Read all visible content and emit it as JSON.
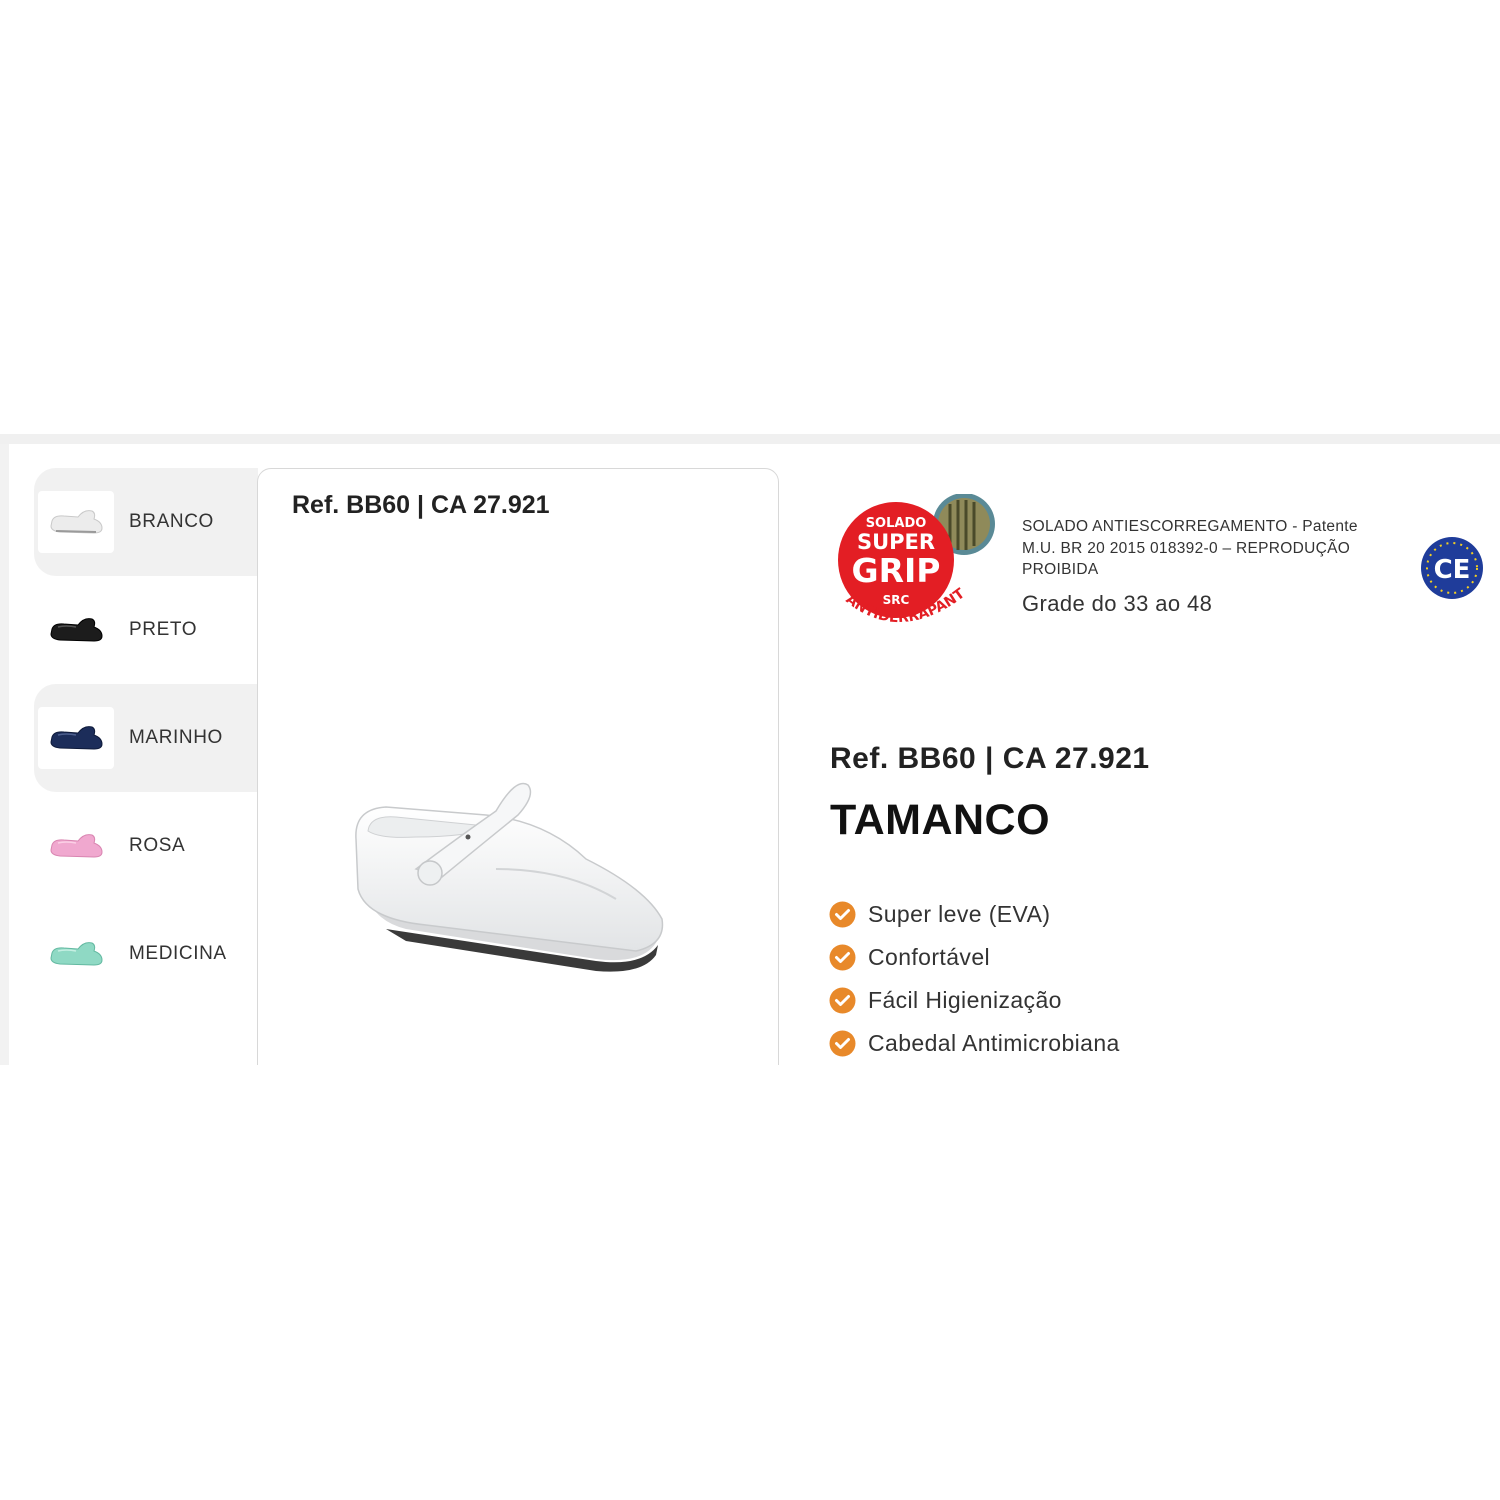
{
  "colors": {
    "accent_orange": "#e8892a",
    "grip_red": "#e31e24",
    "ce_blue": "#1f3c9a",
    "selected_bg": "#f1f1f1"
  },
  "swatches": [
    {
      "label": "BRANCO",
      "shoe_color": "#eeeeee",
      "selected": true
    },
    {
      "label": "PRETO",
      "shoe_color": "#1c1c1c",
      "selected": false
    },
    {
      "label": "MARINHO",
      "shoe_color": "#1c2d5a",
      "selected": true
    },
    {
      "label": "ROSA",
      "shoe_color": "#f0a8cf",
      "selected": false
    },
    {
      "label": "MEDICINA",
      "shoe_color": "#8fd9c4",
      "selected": false
    }
  ],
  "card": {
    "ref": "Ref. BB60 | CA 27.921"
  },
  "badge": {
    "line1": "SOLADO",
    "line2": "SUPER",
    "line3": "GRIP",
    "line4": "SRC",
    "arc": "ANTIDERRAPANTE"
  },
  "patent": {
    "line1": "SOLADO ANTIESCORREGAMENTO - Patente",
    "line2": "M.U. BR 20 2015 018392-0 – REPRODUÇÃO",
    "line3": "PROIBIDA"
  },
  "size_grade": "Grade do 33 ao 48",
  "ce": {
    "mark": "CE"
  },
  "product": {
    "ref": "Ref. BB60 | CA 27.921",
    "title": "TAMANCO"
  },
  "features": [
    "Super leve (EVA)",
    "Confortável",
    "Fácil Higienização",
    "Cabedal Antimicrobiana"
  ]
}
